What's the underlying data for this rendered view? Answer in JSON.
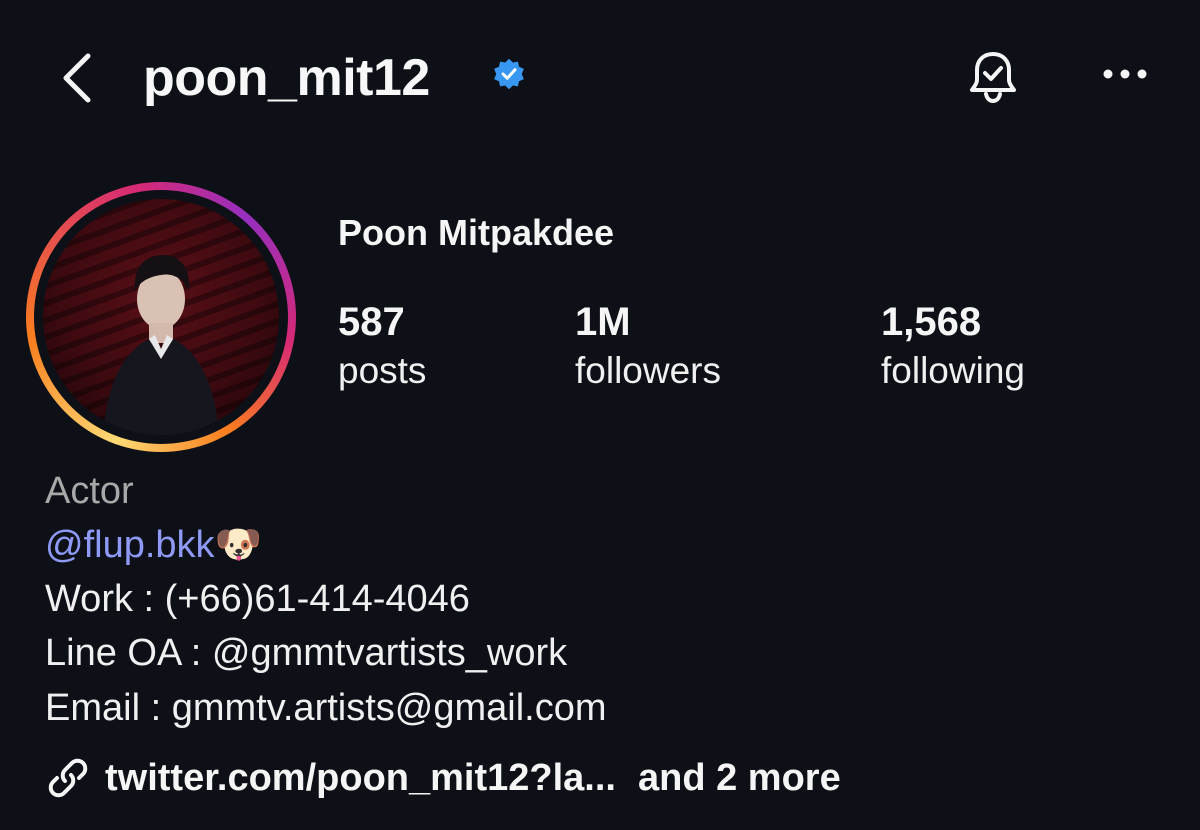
{
  "header": {
    "username": "poon_mit12"
  },
  "profile": {
    "full_name": "Poon Mitpakdee",
    "stats": [
      {
        "count": "587",
        "label": "posts"
      },
      {
        "count": "1M",
        "label": "followers"
      },
      {
        "count": "1,568",
        "label": "following"
      }
    ]
  },
  "bio": {
    "category": "Actor",
    "mention": "@flup.bkk",
    "mention_emoji": "🐶",
    "work": "Work : (+66)61-414-4046",
    "line_oa": "Line OA : @gmmtvartists_work",
    "email": "Email : gmmtv.artists@gmail.com"
  },
  "links": {
    "primary": "twitter.com/poon_mit12?la...",
    "more": "and 2 more"
  },
  "colors": {
    "background": "#0d1016",
    "verified": "#3897f0",
    "mention": "#8e9af5",
    "category": "#a8a8a8"
  },
  "icons": {
    "back": "chevron-left-icon",
    "verified": "verified-badge-icon",
    "notifications": "bell-check-icon",
    "more": "more-horizontal-icon",
    "link": "link-icon"
  }
}
